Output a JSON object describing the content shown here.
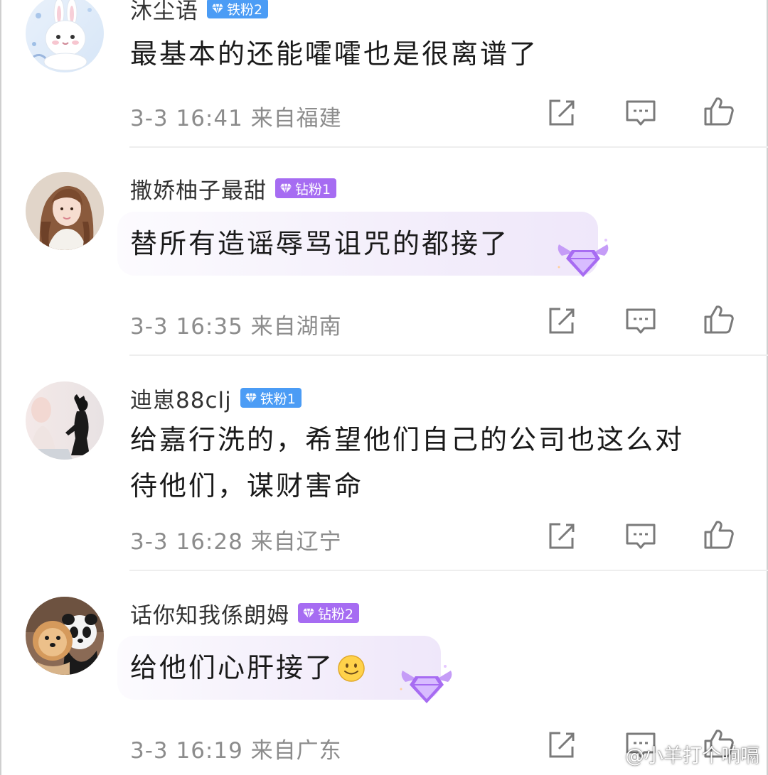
{
  "colors": {
    "iron_badge": "#4b9cf5",
    "diamond_badge": "#a66cf2",
    "content_text": "#1a1a1a",
    "meta_text": "#8c8c8c",
    "icon_stroke": "#7a7a7a"
  },
  "comments": [
    {
      "username": "沐尘语",
      "badge": {
        "label": "铁粉2",
        "type": "iron"
      },
      "lines": [
        "最基本的还能嚯嚯也是很离谱了"
      ],
      "meta": "3-3 16:41 来自福建",
      "avatar": "bunny-avatar"
    },
    {
      "username": "撒娇柚子最甜",
      "badge": {
        "label": "钻粉1",
        "type": "diamond"
      },
      "lines": [
        "替所有造谣辱骂诅咒的都接了"
      ],
      "meta": "3-3 16:35 来自湖南",
      "avatar": "girl-avatar"
    },
    {
      "username": "迪崽88clj",
      "badge": {
        "label": "铁粉1",
        "type": "iron"
      },
      "lines": [
        "给嘉行洗的，希望他们自己的公司也这么对",
        "待他们，谋财害命"
      ],
      "meta": "3-3 16:28 来自辽宁",
      "avatar": "silhouette-avatar"
    },
    {
      "username": "话你知我係朗姆",
      "badge": {
        "label": "钻粉2",
        "type": "diamond"
      },
      "lines": [
        "给他们心肝接了"
      ],
      "meta": "3-3 16:19 来自广东",
      "avatar": "dog-panda-avatar"
    }
  ],
  "actions": {
    "share": "share-icon",
    "comment": "comment-icon",
    "like": "thumbs-up-icon"
  },
  "watermark": {
    "text": "@小羊打个响嗝",
    "icon": "weibo-logo"
  }
}
